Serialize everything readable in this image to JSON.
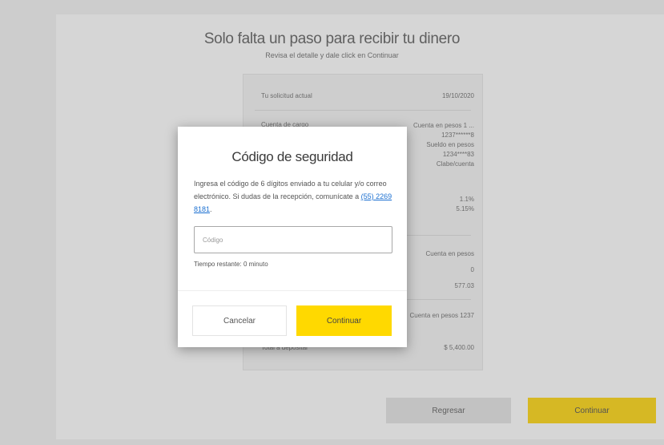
{
  "page": {
    "title": "Solo falta un paso para recibir tu dinero",
    "subtitle": "Revisa el detalle y dale click en Continuar",
    "summary": {
      "rows": [
        {
          "label": "Tu solicitud actual",
          "value": "19/10/2020"
        },
        {
          "label": "Cuenta de cargo",
          "value": "Cuenta en pesos 1 ...\n1237******8\nSueldo en pesos\n1234****83\nClabe/cuenta"
        },
        {
          "label": "",
          "value": "1.1%\n5.15%"
        },
        {
          "label": "",
          "value": "Cuenta en pesos\n0\n577.03"
        },
        {
          "label": "",
          "value": "Cuenta en pesos 1237"
        },
        {
          "label": "Total a depositar",
          "value": "$ 5,400.00"
        }
      ]
    },
    "buttons": {
      "back": "Regresar",
      "continue": "Continuar"
    }
  },
  "modal": {
    "title": "Código de seguridad",
    "text_before_link": "Ingresa el código de 6 dígitos enviado a tu celular y/o correo electrónico. Si dudas de la recepción, comunícate a ",
    "phone_link": "(55) 2269 8181",
    "text_after_link": ".",
    "input_placeholder": "Código",
    "timer_text": "Tiempo restante: 0 minuto",
    "cancel_label": "Cancelar",
    "confirm_label": "Continuar"
  },
  "colors": {
    "accent": "#ffd900",
    "link": "#1a6fd1"
  }
}
